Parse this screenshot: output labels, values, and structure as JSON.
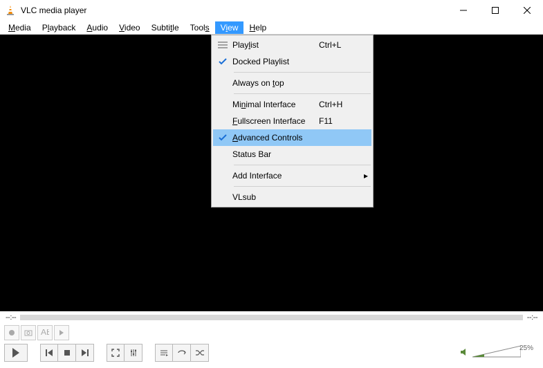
{
  "title": "VLC media player",
  "menubar": {
    "media": "Media",
    "playback": "Playback",
    "audio": "Audio",
    "video": "Video",
    "subtitle": "Subtitle",
    "tools": "Tools",
    "view": "View",
    "help": "Help"
  },
  "view_menu": {
    "playlist": {
      "label": "Playlist",
      "shortcut": "Ctrl+L"
    },
    "docked_playlist": "Docked Playlist",
    "always_on_top": "Always on top",
    "minimal_interface": {
      "label": "Minimal Interface",
      "shortcut": "Ctrl+H"
    },
    "fullscreen_interface": {
      "label": "Fullscreen Interface",
      "shortcut": "F11"
    },
    "advanced_controls": "Advanced Controls",
    "status_bar": "Status Bar",
    "add_interface": "Add Interface",
    "vlsub": "VLsub"
  },
  "seek": {
    "current": "--:--",
    "total": "--:--"
  },
  "volume": {
    "percent": "25%"
  }
}
